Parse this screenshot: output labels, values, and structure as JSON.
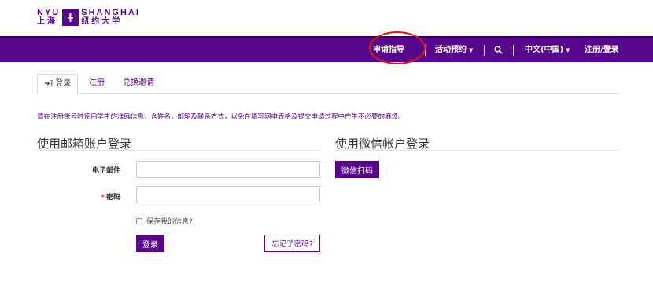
{
  "logo": {
    "en_top": "NYU",
    "cn_left": "上海",
    "en_right": "SHANGHAI",
    "cn_right": "纽约大学"
  },
  "nav": {
    "apply_guide": "申请指导",
    "events": "活动预约",
    "language": "中文(中国)",
    "register_login": "注册/登录",
    "search_icon": "search-icon"
  },
  "tabs": {
    "login": "登录",
    "register": "注册",
    "redeem": "兑换邀请"
  },
  "notice": "请在注册账号时使用学生的准确信息，含姓名，邮箱及联系方式，以免在填写网申表格及提交申请过程中产生不必要的麻烦。",
  "email_login": {
    "title": "使用邮箱账户登录",
    "email_label": "电子邮件",
    "password_label": "密码",
    "required_mark": "*",
    "email_value": "",
    "password_value": "",
    "remember_label": "保存我的信息?",
    "login_button": "登录",
    "forgot_button": "忘记了密码?"
  },
  "wechat_login": {
    "title": "使用微信帐户登录",
    "scan_button": "微信扫码"
  },
  "colors": {
    "brand": "#57068c",
    "highlight_circle": "#e01515"
  }
}
